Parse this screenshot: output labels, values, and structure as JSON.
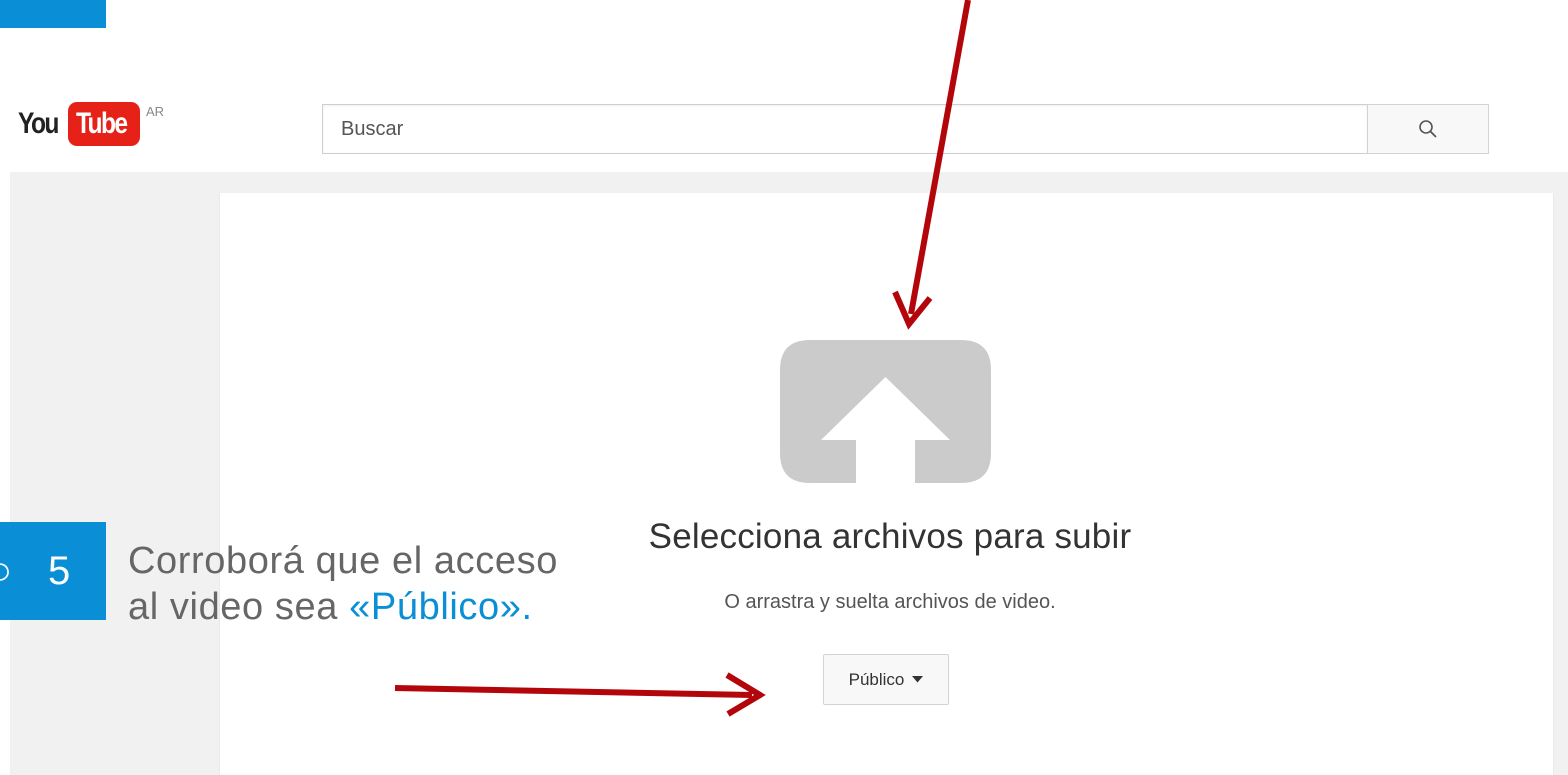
{
  "header": {
    "logo_you": "You",
    "logo_tube": "Tube",
    "logo_country": "AR",
    "search_placeholder": "Buscar"
  },
  "upload": {
    "title": "Selecciona archivos para subir",
    "subtitle": "O arrastra y suelta archivos de video.",
    "privacy_label": "Público"
  },
  "tutorial": {
    "step_symbol": "○",
    "step_number": "5",
    "instruction_prefix": "Corroborá que el acceso al video sea ",
    "instruction_highlight": "«Público»."
  },
  "colors": {
    "accent_blue": "#0a8fd6",
    "arrow_red": "#b3060b",
    "youtube_red": "#e62117"
  }
}
